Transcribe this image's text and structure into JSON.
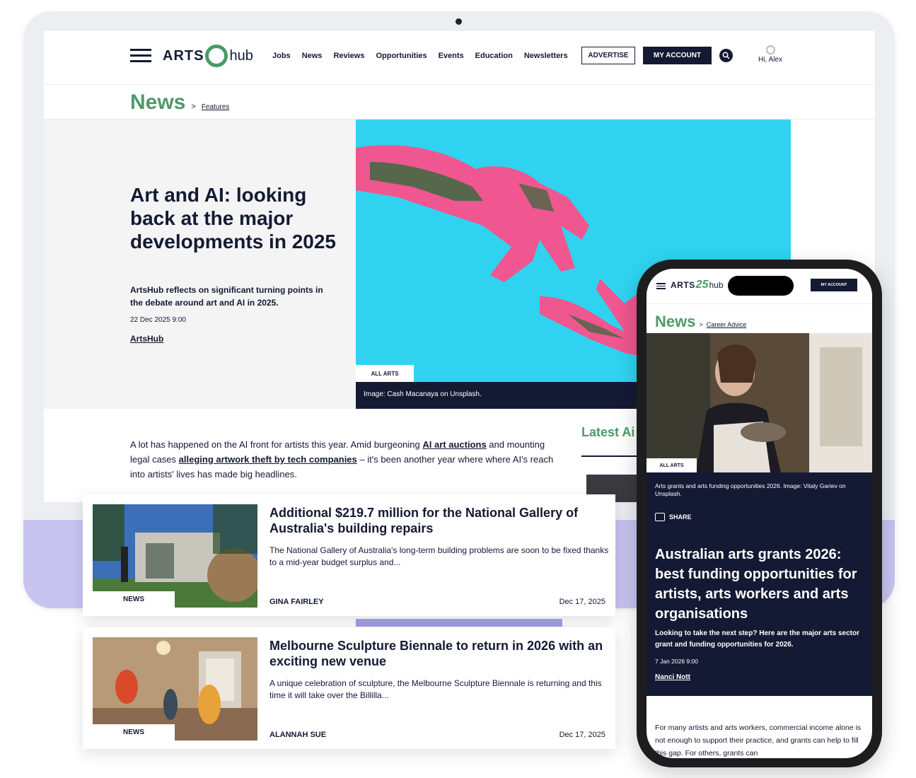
{
  "desktop": {
    "header": {
      "logo_arts": "ARTS",
      "logo_hub": "hub",
      "nav": [
        "Jobs",
        "News",
        "Reviews",
        "Opportunities",
        "Events",
        "Education",
        "Newsletters"
      ],
      "advertise_label": "ADVERTISE",
      "account_label": "MY ACCOUNT",
      "user_greeting": "Hi, Alex"
    },
    "breadcrumb": {
      "section": "News",
      "separator": ">",
      "sub": "Features"
    },
    "hero": {
      "title": "Art and AI: looking back at the major developments in 2025",
      "subtitle": "ArtsHub reflects on significant turning points in the debate around art and AI in 2025.",
      "date": "22 Dec 2025 9:00",
      "author": "ArtsHub",
      "tag": "ALL ARTS",
      "caption": "Image: Cash Macanaya on Unsplash."
    },
    "body": {
      "p1_a": "A lot has happened on the AI front for artists this year. Amid burgeoning ",
      "p1_link1": "AI art auctions",
      "p1_b": " and mounting legal cases ",
      "p1_link2": "alleging artwork theft by tech companies",
      "p1_c": " – it's been another year where where AI's reach into artists' lives has made big headlines."
    },
    "sidebar": {
      "latest_heading": "Latest Ai"
    }
  },
  "cards": [
    {
      "title": "Additional $219.7 million for the National Gallery of Australia's building repairs",
      "excerpt": "The National Gallery of Australia's long-term building problems are soon to be fixed thanks to a mid-year budget surplus and...",
      "author": "GINA FAIRLEY",
      "date": "Dec 17, 2025",
      "tag": "NEWS"
    },
    {
      "title": "Melbourne Sculpture Biennale to return in 2026 with an exciting new venue",
      "excerpt": "A unique celebration of sculpture, the Melbourne Sculpture Biennale is returning and this time it will take over the Billilla...",
      "author": "ALANNAH SUE",
      "date": "Dec 17, 2025",
      "tag": "NEWS"
    }
  ],
  "phone": {
    "logo_arts": "ARTS",
    "logo_25": "25",
    "logo_hub": "hub",
    "account_label": "MY ACCOUNT",
    "breadcrumb": {
      "section": "News",
      "separator": ">",
      "sub": "Career Advice"
    },
    "tag": "ALL ARTS",
    "caption": "Arts grants and arts funding opportunities 2026. Image: Vitaly Gariev on Unsplash.",
    "share_label": "SHARE",
    "title": "Australian arts grants 2026: best funding opportunities for artists, arts workers and arts organisations",
    "subtitle": "Looking to take the next step? Here are the major arts sector grant and funding opportunities for 2026.",
    "date": "7 Jan 2026 9:00",
    "author": "Nanci Nott",
    "body": "For many artists and arts workers, commercial income alone is not enough to support their practice, and grants can help to fill this gap. For others, grants can"
  },
  "colors": {
    "brand_green": "#4c9a6a",
    "navy": "#141a33",
    "hero_bg": "#2fd3ef",
    "accent_pink": "#f0568f",
    "lavender": "#c7c5f0"
  }
}
